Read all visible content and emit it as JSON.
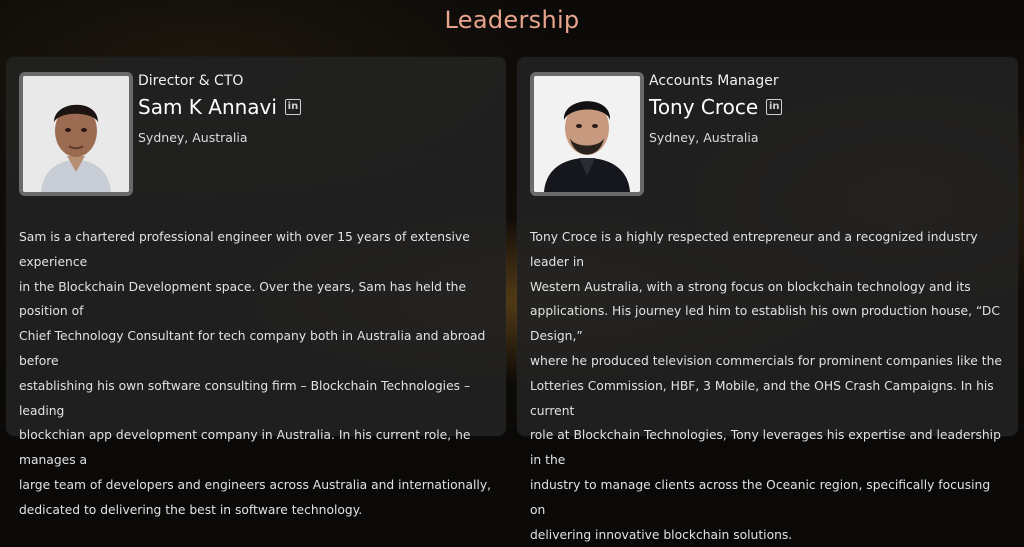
{
  "section": {
    "title": "Leadership"
  },
  "people": [
    {
      "role": "Director & CTO",
      "name": "Sam K Annavi",
      "location": "Sydney, Australia",
      "linkedin_icon": "linkedin-icon",
      "bio_lines": [
        "Sam is a chartered professional engineer with over 15 years of extensive experience",
        "in the Blockchain Development space. Over the years, Sam has held the position of",
        "Chief Technology Consultant for tech company both in Australia and abroad before",
        "establishing his own software consulting firm – Blockchain Technologies – leading",
        "blockchian app development company in Australia. In his current role, he manages a",
        "large team of developers and engineers across Australia and internationally,",
        "dedicated to delivering the best in software technology."
      ]
    },
    {
      "role": "Accounts Manager",
      "name": "Tony Croce",
      "location": "Sydney, Australia",
      "linkedin_icon": "linkedin-icon",
      "bio_lines": [
        "Tony Croce is a highly respected entrepreneur and a recognized industry leader in",
        "Western Australia, with a strong focus on blockchain technology and its",
        "applications. His journey led him to establish his own production house, “DC Design,”",
        "where he produced television commercials for prominent companies like the",
        "Lotteries Commission, HBF, 3 Mobile, and the OHS Crash Campaigns. In his current",
        "role at Blockchain Technologies, Tony leverages his expertise and leadership in the",
        "industry to manage clients across the Oceanic region, specifically focusing on",
        "delivering innovative blockchain solutions."
      ]
    }
  ],
  "colors": {
    "heading": "#e8a48c",
    "card_bg": "#222222",
    "photo_border": "#6a6a6a"
  }
}
